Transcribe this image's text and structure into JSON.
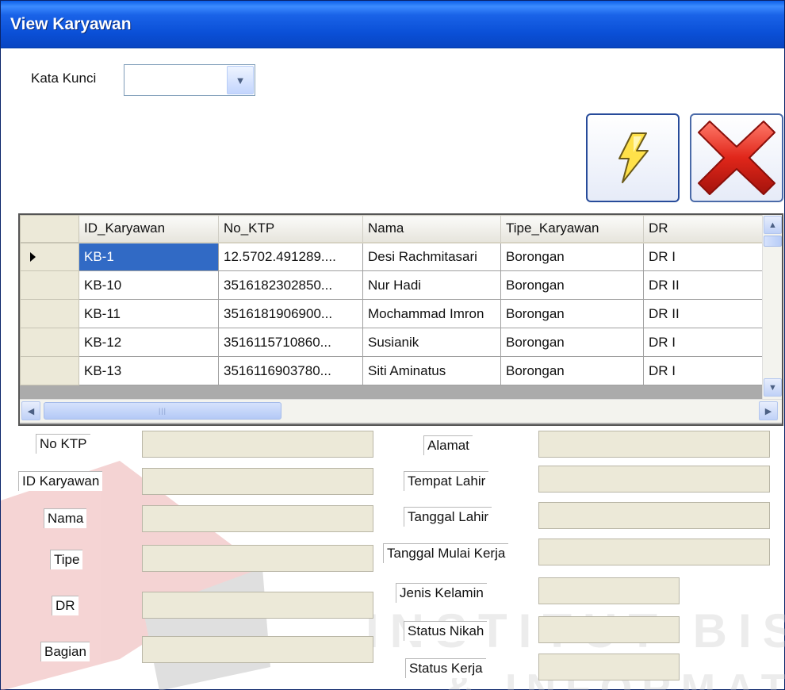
{
  "window": {
    "title": "View Karyawan"
  },
  "search": {
    "label": "Kata Kunci",
    "value": ""
  },
  "buttons": {
    "refresh_icon": "lightning-icon",
    "close_icon": "red-x-icon"
  },
  "grid": {
    "columns": [
      "ID_Karyawan",
      "No_KTP",
      "Nama",
      "Tipe_Karyawan",
      "DR"
    ],
    "rows": [
      [
        "KB-1",
        "12.5702.491289....",
        "Desi Rachmitasari",
        "Borongan",
        "DR I"
      ],
      [
        "KB-10",
        "3516182302850...",
        "Nur Hadi",
        "Borongan",
        "DR II"
      ],
      [
        "KB-11",
        "3516181906900...",
        "Mochammad Imron",
        "Borongan",
        "DR II"
      ],
      [
        "KB-12",
        "3516115710860...",
        "Susianik",
        "Borongan",
        "DR I"
      ],
      [
        "KB-13",
        "3516116903780...",
        "Siti Aminatus",
        "Borongan",
        "DR I"
      ]
    ],
    "selected_row": 0
  },
  "form": {
    "left_labels": [
      "No KTP",
      "ID Karyawan",
      "Nama",
      "Tipe",
      "DR",
      "Bagian"
    ],
    "right_labels": [
      "Alamat",
      "Tempat Lahir",
      "Tanggal Lahir",
      "Tanggal Mulai Kerja",
      "Jenis Kelamin",
      "Status Nikah",
      "Status Kerja"
    ]
  },
  "watermark": {
    "text1": "INSTITUT BISNIS",
    "text2": "& INFORMATIKA",
    "color": "#c9c9c9",
    "logo_colors": [
      "#e8a0a0",
      "#b9b9b9"
    ]
  }
}
